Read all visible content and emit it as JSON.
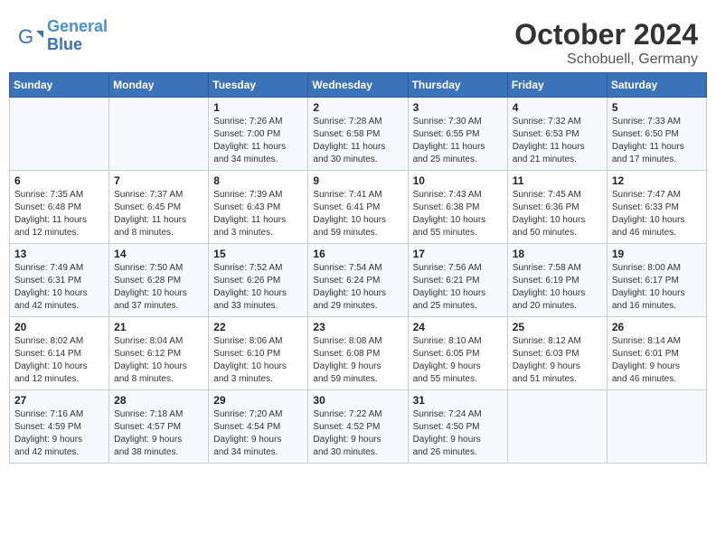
{
  "header": {
    "logo_line1": "General",
    "logo_line2": "Blue",
    "month": "October 2024",
    "location": "Schobuell, Germany"
  },
  "days_of_week": [
    "Sunday",
    "Monday",
    "Tuesday",
    "Wednesday",
    "Thursday",
    "Friday",
    "Saturday"
  ],
  "weeks": [
    [
      {
        "day": "",
        "info": ""
      },
      {
        "day": "",
        "info": ""
      },
      {
        "day": "1",
        "info": "Sunrise: 7:26 AM\nSunset: 7:00 PM\nDaylight: 11 hours\nand 34 minutes."
      },
      {
        "day": "2",
        "info": "Sunrise: 7:28 AM\nSunset: 6:58 PM\nDaylight: 11 hours\nand 30 minutes."
      },
      {
        "day": "3",
        "info": "Sunrise: 7:30 AM\nSunset: 6:55 PM\nDaylight: 11 hours\nand 25 minutes."
      },
      {
        "day": "4",
        "info": "Sunrise: 7:32 AM\nSunset: 6:53 PM\nDaylight: 11 hours\nand 21 minutes."
      },
      {
        "day": "5",
        "info": "Sunrise: 7:33 AM\nSunset: 6:50 PM\nDaylight: 11 hours\nand 17 minutes."
      }
    ],
    [
      {
        "day": "6",
        "info": "Sunrise: 7:35 AM\nSunset: 6:48 PM\nDaylight: 11 hours\nand 12 minutes."
      },
      {
        "day": "7",
        "info": "Sunrise: 7:37 AM\nSunset: 6:45 PM\nDaylight: 11 hours\nand 8 minutes."
      },
      {
        "day": "8",
        "info": "Sunrise: 7:39 AM\nSunset: 6:43 PM\nDaylight: 11 hours\nand 3 minutes."
      },
      {
        "day": "9",
        "info": "Sunrise: 7:41 AM\nSunset: 6:41 PM\nDaylight: 10 hours\nand 59 minutes."
      },
      {
        "day": "10",
        "info": "Sunrise: 7:43 AM\nSunset: 6:38 PM\nDaylight: 10 hours\nand 55 minutes."
      },
      {
        "day": "11",
        "info": "Sunrise: 7:45 AM\nSunset: 6:36 PM\nDaylight: 10 hours\nand 50 minutes."
      },
      {
        "day": "12",
        "info": "Sunrise: 7:47 AM\nSunset: 6:33 PM\nDaylight: 10 hours\nand 46 minutes."
      }
    ],
    [
      {
        "day": "13",
        "info": "Sunrise: 7:49 AM\nSunset: 6:31 PM\nDaylight: 10 hours\nand 42 minutes."
      },
      {
        "day": "14",
        "info": "Sunrise: 7:50 AM\nSunset: 6:28 PM\nDaylight: 10 hours\nand 37 minutes."
      },
      {
        "day": "15",
        "info": "Sunrise: 7:52 AM\nSunset: 6:26 PM\nDaylight: 10 hours\nand 33 minutes."
      },
      {
        "day": "16",
        "info": "Sunrise: 7:54 AM\nSunset: 6:24 PM\nDaylight: 10 hours\nand 29 minutes."
      },
      {
        "day": "17",
        "info": "Sunrise: 7:56 AM\nSunset: 6:21 PM\nDaylight: 10 hours\nand 25 minutes."
      },
      {
        "day": "18",
        "info": "Sunrise: 7:58 AM\nSunset: 6:19 PM\nDaylight: 10 hours\nand 20 minutes."
      },
      {
        "day": "19",
        "info": "Sunrise: 8:00 AM\nSunset: 6:17 PM\nDaylight: 10 hours\nand 16 minutes."
      }
    ],
    [
      {
        "day": "20",
        "info": "Sunrise: 8:02 AM\nSunset: 6:14 PM\nDaylight: 10 hours\nand 12 minutes."
      },
      {
        "day": "21",
        "info": "Sunrise: 8:04 AM\nSunset: 6:12 PM\nDaylight: 10 hours\nand 8 minutes."
      },
      {
        "day": "22",
        "info": "Sunrise: 8:06 AM\nSunset: 6:10 PM\nDaylight: 10 hours\nand 3 minutes."
      },
      {
        "day": "23",
        "info": "Sunrise: 8:08 AM\nSunset: 6:08 PM\nDaylight: 9 hours\nand 59 minutes."
      },
      {
        "day": "24",
        "info": "Sunrise: 8:10 AM\nSunset: 6:05 PM\nDaylight: 9 hours\nand 55 minutes."
      },
      {
        "day": "25",
        "info": "Sunrise: 8:12 AM\nSunset: 6:03 PM\nDaylight: 9 hours\nand 51 minutes."
      },
      {
        "day": "26",
        "info": "Sunrise: 8:14 AM\nSunset: 6:01 PM\nDaylight: 9 hours\nand 46 minutes."
      }
    ],
    [
      {
        "day": "27",
        "info": "Sunrise: 7:16 AM\nSunset: 4:59 PM\nDaylight: 9 hours\nand 42 minutes."
      },
      {
        "day": "28",
        "info": "Sunrise: 7:18 AM\nSunset: 4:57 PM\nDaylight: 9 hours\nand 38 minutes."
      },
      {
        "day": "29",
        "info": "Sunrise: 7:20 AM\nSunset: 4:54 PM\nDaylight: 9 hours\nand 34 minutes."
      },
      {
        "day": "30",
        "info": "Sunrise: 7:22 AM\nSunset: 4:52 PM\nDaylight: 9 hours\nand 30 minutes."
      },
      {
        "day": "31",
        "info": "Sunrise: 7:24 AM\nSunset: 4:50 PM\nDaylight: 9 hours\nand 26 minutes."
      },
      {
        "day": "",
        "info": ""
      },
      {
        "day": "",
        "info": ""
      }
    ]
  ]
}
